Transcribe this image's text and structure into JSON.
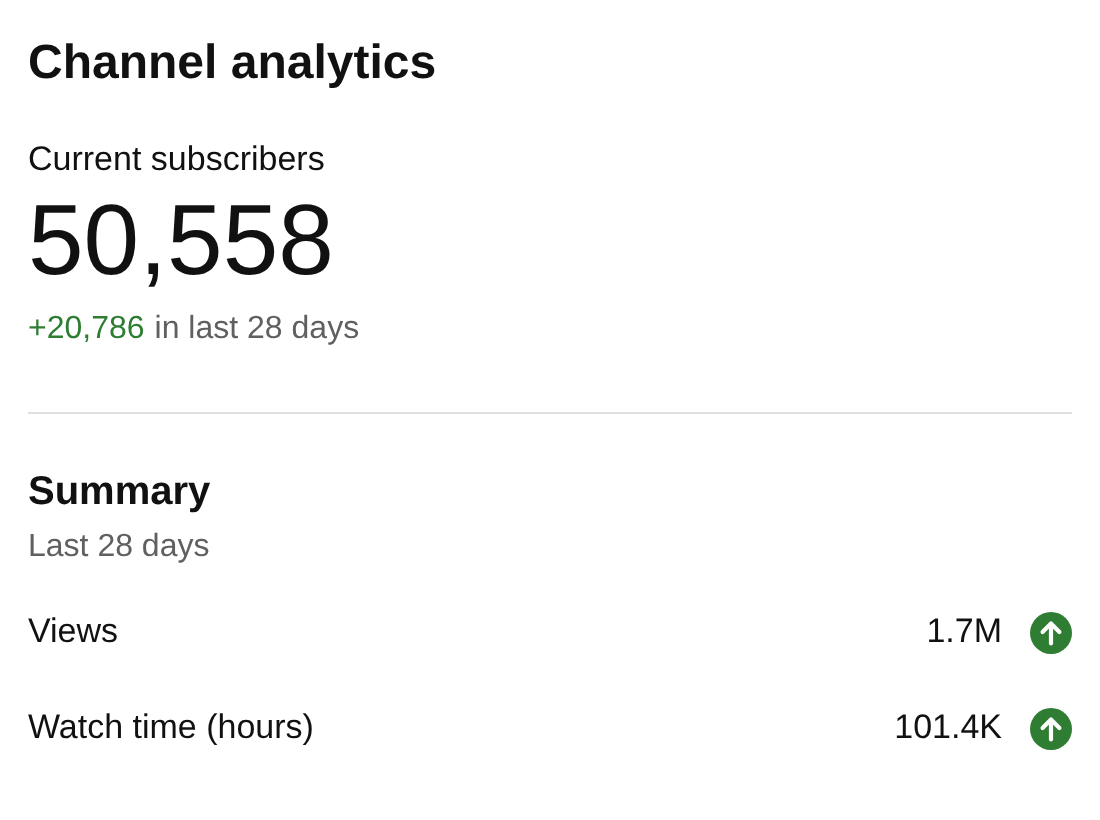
{
  "title": "Channel analytics",
  "subscribers": {
    "label": "Current subscribers",
    "count": "50,558",
    "change": "+20,786",
    "period": "in last 28 days"
  },
  "summary": {
    "title": "Summary",
    "period": "Last 28 days",
    "metrics": [
      {
        "name": "Views",
        "value": "1.7M",
        "kind": "up"
      },
      {
        "name": "Watch time (hours)",
        "value": "101.4K",
        "kind": "up"
      }
    ]
  }
}
